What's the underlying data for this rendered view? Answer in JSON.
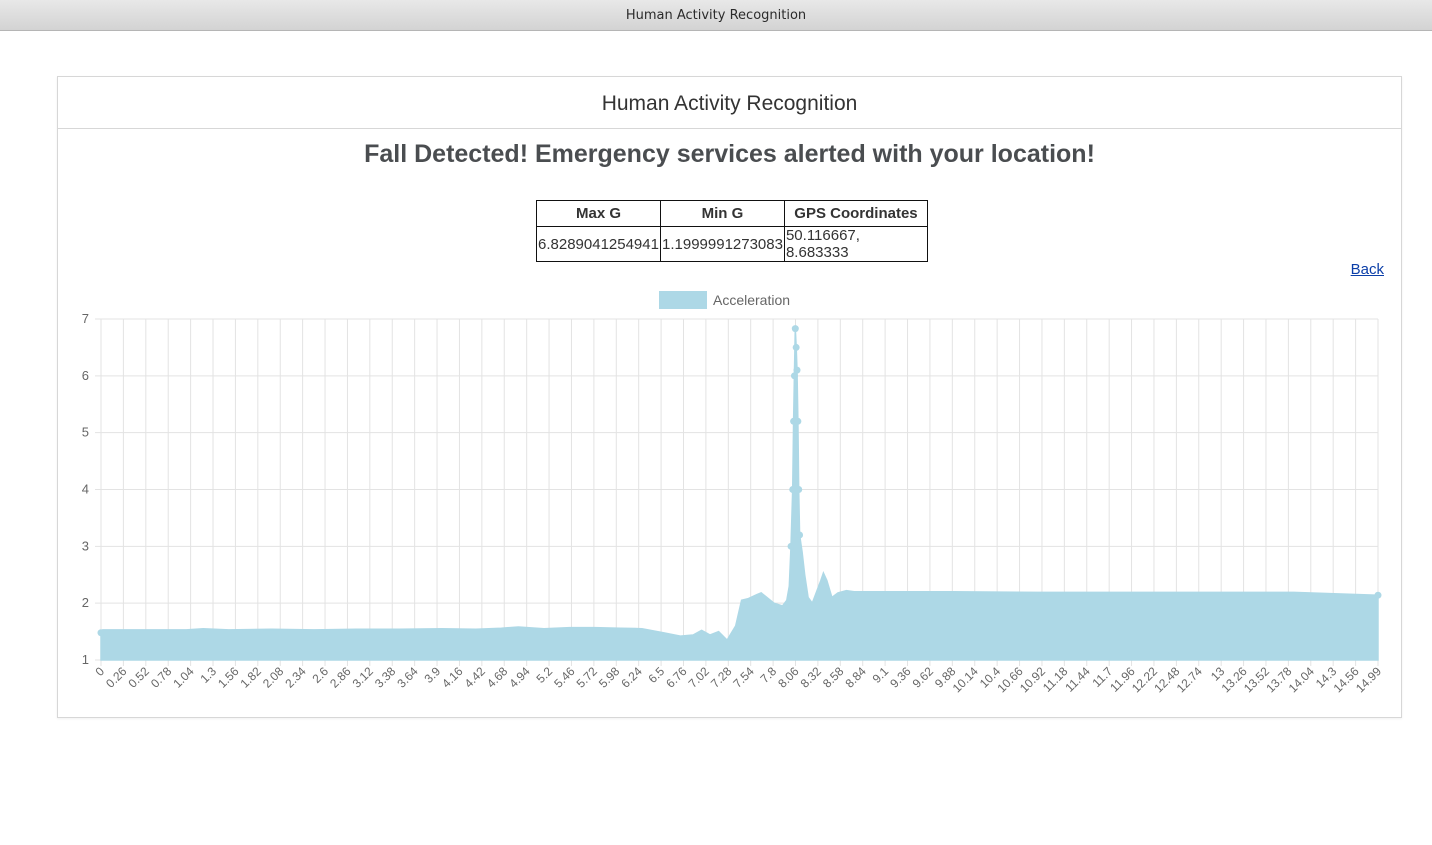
{
  "window": {
    "title": "Human Activity Recognition"
  },
  "panel": {
    "heading": "Human Activity Recognition",
    "alert": "Fall Detected! Emergency services alerted with your location!",
    "back_label": "Back"
  },
  "stats_table": {
    "headers": [
      "Max G",
      "Min G",
      "GPS Coordinates"
    ],
    "row": [
      "6.8289041254941",
      "1.1999991273083",
      "50.116667, 8.683333"
    ]
  },
  "colors": {
    "series": "#add8e6",
    "grid": "#e3e3e3",
    "tick_text": "#666666"
  },
  "chart_data": {
    "type": "area",
    "legend_position": "top",
    "grid": true,
    "ylim": [
      1,
      7
    ],
    "yticks": [
      1,
      2,
      3,
      4,
      5,
      6,
      7
    ],
    "xticks": [
      "0",
      "0.26",
      "0.52",
      "0.78",
      "1.04",
      "1.3",
      "1.56",
      "1.82",
      "2.08",
      "2.34",
      "2.6",
      "2.86",
      "3.12",
      "3.38",
      "3.64",
      "3.9",
      "4.16",
      "4.42",
      "4.68",
      "4.94",
      "5.2",
      "5.46",
      "5.72",
      "5.98",
      "6.24",
      "6.5",
      "6.76",
      "7.02",
      "7.28",
      "7.54",
      "7.8",
      "8.06",
      "8.32",
      "8.58",
      "8.84",
      "9.1",
      "9.36",
      "9.62",
      "9.88",
      "10.14",
      "10.4",
      "10.66",
      "10.92",
      "11.18",
      "11.44",
      "11.7",
      "11.96",
      "12.22",
      "12.48",
      "12.74",
      "13",
      "13.26",
      "13.52",
      "13.78",
      "14.04",
      "14.3",
      "14.56",
      "14.99"
    ],
    "series": [
      {
        "name": "Acceleration",
        "points": [
          [
            0,
            1.48
          ],
          [
            0.02,
            1.53
          ],
          [
            0.5,
            1.53
          ],
          [
            1.0,
            1.53
          ],
          [
            1.2,
            1.55
          ],
          [
            1.5,
            1.53
          ],
          [
            2.0,
            1.54
          ],
          [
            2.5,
            1.53
          ],
          [
            3.0,
            1.54
          ],
          [
            3.5,
            1.54
          ],
          [
            4.0,
            1.55
          ],
          [
            4.4,
            1.54
          ],
          [
            4.7,
            1.56
          ],
          [
            4.9,
            1.58
          ],
          [
            5.2,
            1.55
          ],
          [
            5.5,
            1.57
          ],
          [
            5.8,
            1.57
          ],
          [
            6.1,
            1.56
          ],
          [
            6.35,
            1.55
          ],
          [
            6.6,
            1.48
          ],
          [
            6.8,
            1.42
          ],
          [
            6.95,
            1.44
          ],
          [
            7.05,
            1.52
          ],
          [
            7.15,
            1.44
          ],
          [
            7.25,
            1.5
          ],
          [
            7.35,
            1.35
          ],
          [
            7.45,
            1.6
          ],
          [
            7.52,
            2.05
          ],
          [
            7.6,
            2.08
          ],
          [
            7.7,
            2.15
          ],
          [
            7.75,
            2.18
          ],
          [
            7.8,
            2.12
          ],
          [
            7.9,
            2.0
          ],
          [
            8.0,
            1.95
          ],
          [
            8.05,
            2.05
          ],
          [
            8.08,
            2.3
          ],
          [
            8.1,
            3.0
          ],
          [
            8.12,
            4.0
          ],
          [
            8.13,
            5.2
          ],
          [
            8.14,
            6.0
          ],
          [
            8.15,
            6.83
          ],
          [
            8.16,
            6.5
          ],
          [
            8.17,
            6.1
          ],
          [
            8.18,
            5.2
          ],
          [
            8.19,
            4.0
          ],
          [
            8.2,
            3.2
          ],
          [
            8.23,
            2.9
          ],
          [
            8.26,
            2.5
          ],
          [
            8.3,
            2.1
          ],
          [
            8.35,
            2.0
          ],
          [
            8.4,
            2.2
          ],
          [
            8.45,
            2.4
          ],
          [
            8.48,
            2.53
          ],
          [
            8.52,
            2.4
          ],
          [
            8.58,
            2.1
          ],
          [
            8.65,
            2.18
          ],
          [
            8.75,
            2.22
          ],
          [
            8.84,
            2.2
          ],
          [
            9.0,
            2.2
          ],
          [
            10.0,
            2.2
          ],
          [
            11.0,
            2.19
          ],
          [
            12.0,
            2.19
          ],
          [
            13.0,
            2.19
          ],
          [
            14.0,
            2.19
          ],
          [
            14.99,
            2.14
          ]
        ]
      }
    ]
  }
}
